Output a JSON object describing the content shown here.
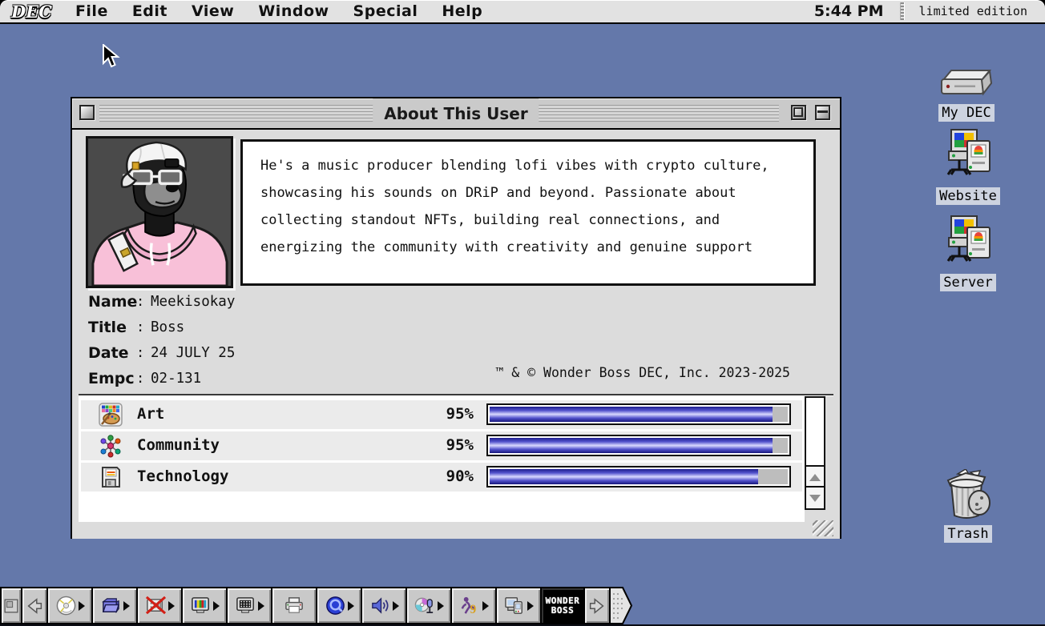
{
  "menu_bar": {
    "logo": "DEC",
    "items": [
      "File",
      "Edit",
      "View",
      "Window",
      "Special",
      "Help"
    ],
    "clock": "5:44 PM",
    "edition": "limited edition"
  },
  "window": {
    "title": "About This User",
    "description": "He's a music producer blending lofi vibes with crypto culture, showcasing his sounds on DRiP and beyond. Passionate about collecting standout NFTs, building real connections, and energizing the community with creativity and genuine support",
    "field_separator": ":",
    "fields": [
      {
        "label": "Name",
        "value": "Meekisokay"
      },
      {
        "label": "Title",
        "value": "Boss"
      },
      {
        "label": "Date",
        "value": "24 JULY 25"
      },
      {
        "label": "Empc",
        "value": "02-131"
      }
    ],
    "copyright": "™ & © Wonder Boss DEC, Inc. 2023-2025",
    "skills": [
      {
        "name": "Art",
        "percent": 95,
        "percent_label": "95%",
        "icon": "palette-icon"
      },
      {
        "name": "Community",
        "percent": 95,
        "percent_label": "95%",
        "icon": "community-icon"
      },
      {
        "name": "Technology",
        "percent": 90,
        "percent_label": "90%",
        "icon": "floppy-icon"
      }
    ]
  },
  "desktop_icons": [
    {
      "label": "My DEC",
      "icon": "hard-drive-icon"
    },
    {
      "label": "Website",
      "icon": "network-computers-icon"
    },
    {
      "label": "Server",
      "icon": "network-computers-icon"
    },
    {
      "label": "Trash",
      "icon": "trash-full-icon"
    }
  ],
  "control_strip": {
    "items": [
      "strip-collapse-tab",
      "scroll-left",
      "cd",
      "folder",
      "file-sharing-off",
      "display-colors",
      "display-resolution",
      "printer",
      "quicktime",
      "volume",
      "sound-input",
      "macos9-runner",
      "device-sync",
      "wonder-boss",
      "scroll-right",
      "end-tab"
    ],
    "wonder_boss_line1": "WONDER",
    "wonder_boss_line2": "BOSS"
  },
  "colors": {
    "desktop": "#6478aa",
    "window_bg": "#dcdcdc",
    "bar_fill_dark": "#1d1d8c",
    "bar_fill_light": "#d9d9ff",
    "bar_track": "#bdbdbd",
    "label_bg": "#cdd3e0",
    "wonder_badge_bg": "#000000"
  }
}
